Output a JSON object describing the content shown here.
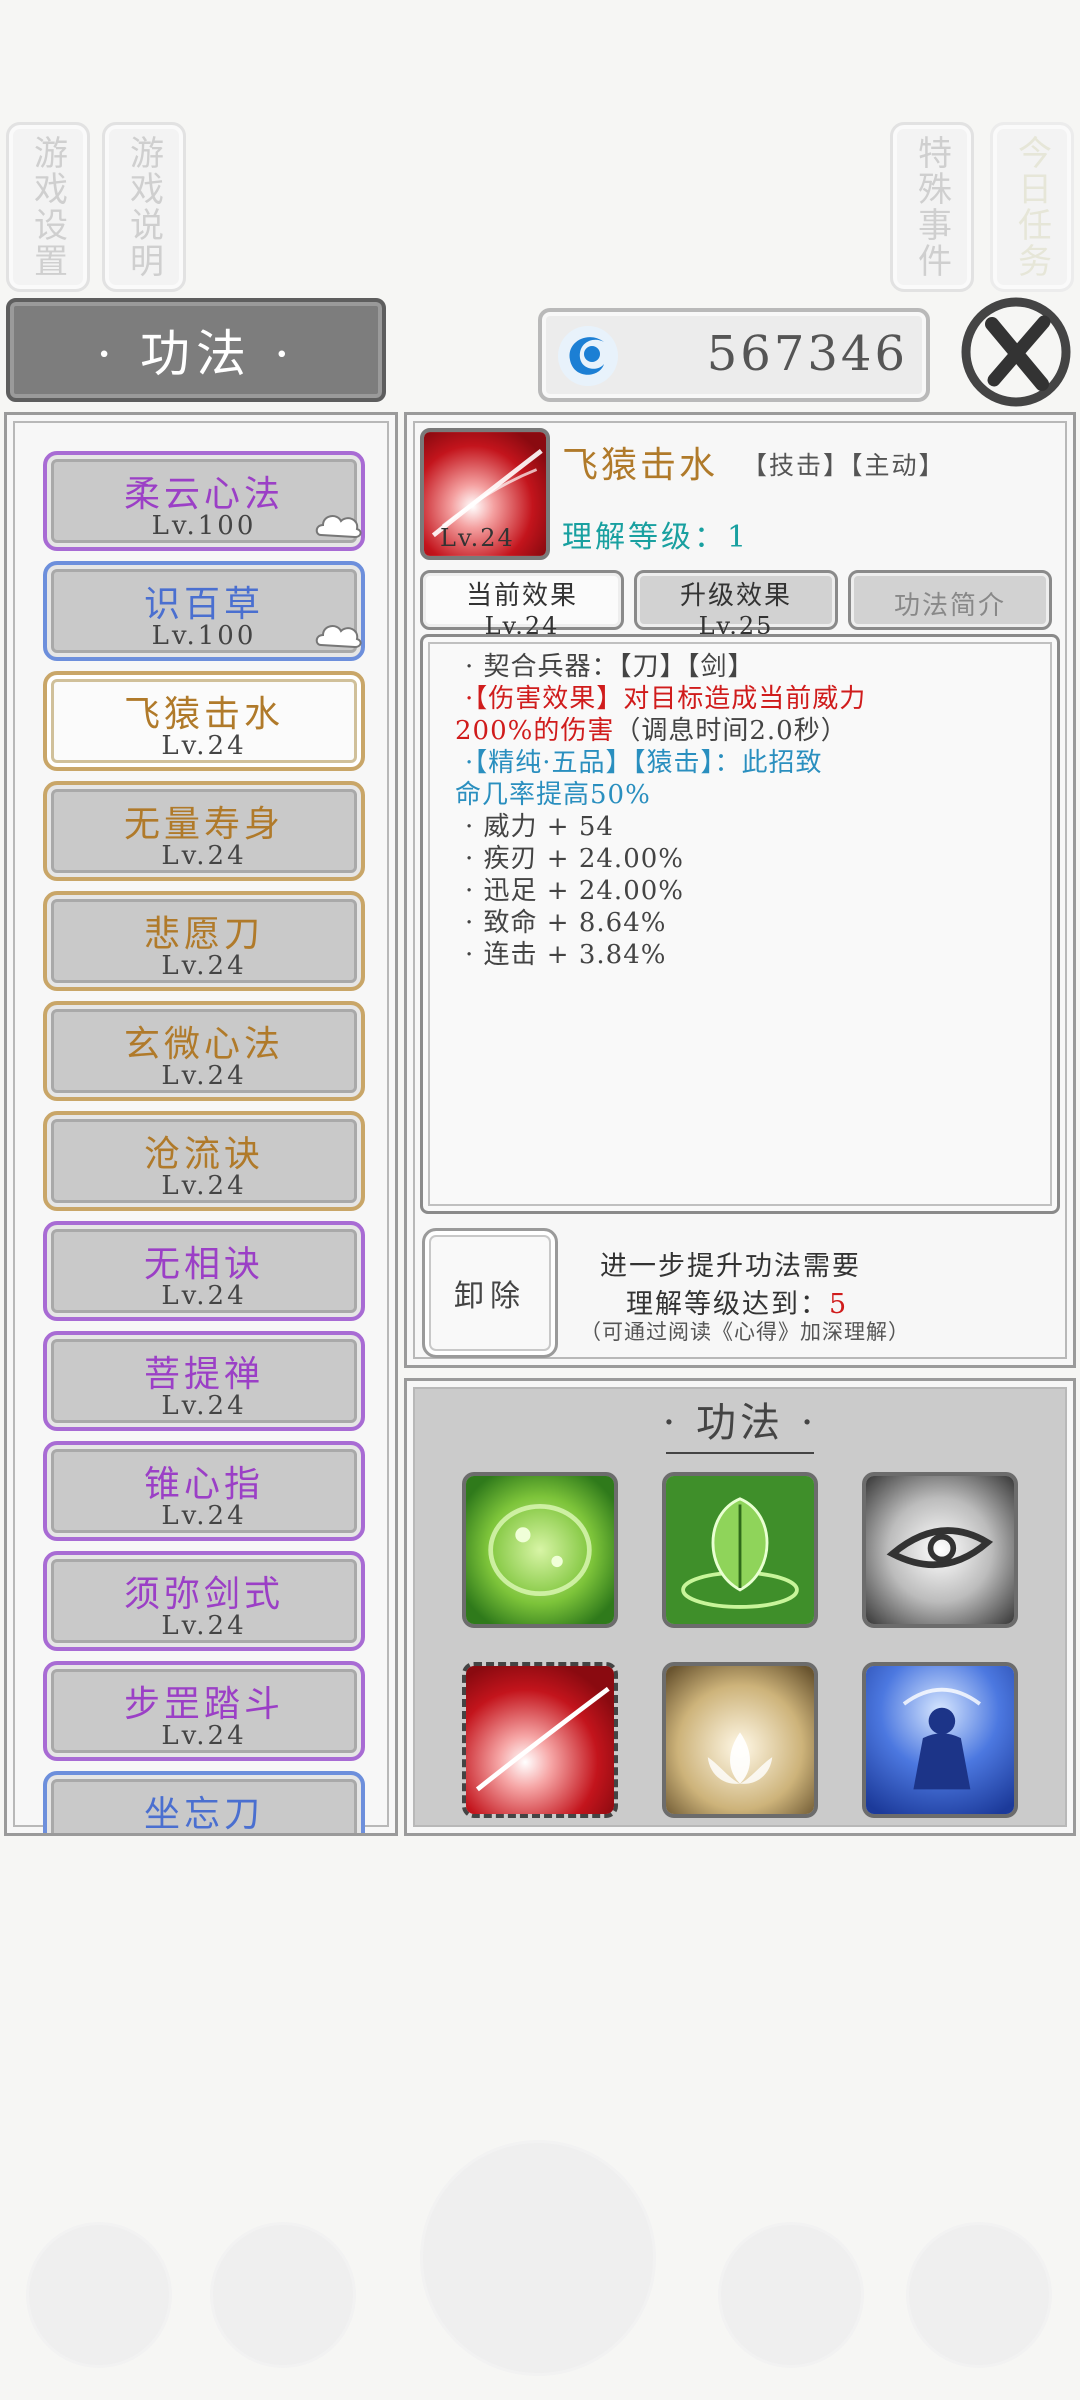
{
  "side_tabs": {
    "settings": "游戏设置",
    "help": "游戏说明",
    "events": "特殊事件",
    "daily": "今日任务"
  },
  "header": {
    "title": "· 功法 ·",
    "currency": "567346",
    "close_icon": "close-x-icon"
  },
  "skill_list": [
    {
      "name": "柔云心法",
      "level": "Lv.100",
      "color": "purple",
      "badge": true
    },
    {
      "name": "识百草",
      "level": "Lv.100",
      "color": "blue",
      "badge": true
    },
    {
      "name": "飞猿击水",
      "level": "Lv.24",
      "color": "gold",
      "active": true
    },
    {
      "name": "无量寿身",
      "level": "Lv.24",
      "color": "gold"
    },
    {
      "name": "悲愿刀",
      "level": "Lv.24",
      "color": "gold"
    },
    {
      "name": "玄微心法",
      "level": "Lv.24",
      "color": "gold"
    },
    {
      "name": "沧流诀",
      "level": "Lv.24",
      "color": "gold"
    },
    {
      "name": "无相诀",
      "level": "Lv.24",
      "color": "purple"
    },
    {
      "name": "菩提禅",
      "level": "Lv.24",
      "color": "purple"
    },
    {
      "name": "锥心指",
      "level": "Lv.24",
      "color": "purple"
    },
    {
      "name": "须弥剑式",
      "level": "Lv.24",
      "color": "purple"
    },
    {
      "name": "步罡踏斗",
      "level": "Lv.24",
      "color": "purple"
    },
    {
      "name": "坐忘刀",
      "level": "",
      "color": "blue"
    }
  ],
  "detail": {
    "icon_level": "Lv.24",
    "name": "飞猿击水",
    "tags": "【技击】【主动】",
    "understanding": "理解等级：1",
    "tabs": [
      {
        "label": "当前效果",
        "sub": "Lv.24"
      },
      {
        "label": "升级效果",
        "sub": "Lv.25"
      },
      {
        "label": "功法简介",
        "sub": ""
      }
    ],
    "effects": {
      "weapon": "· 契合兵器：【刀】【剑】",
      "damage_a": "·【伤害效果】对目标造成当前威力",
      "damage_b_red": "200%的伤害",
      "damage_b_gray": "（调息时间2.0秒）",
      "bonus_a": "·【精纯·五品】【猿击】：此招致",
      "bonus_b": "命几率提高50%",
      "stats": [
        "· 威力 + 54",
        "· 疾刃 + 24.00%",
        "· 迅足 + 24.00%",
        "· 致命 + 8.64%",
        "· 连击 + 3.84%"
      ]
    },
    "unequip": "卸除",
    "requirement_line1": "进一步提升功法需要",
    "requirement_line2": "理解等级达到：",
    "requirement_value": "5",
    "requirement_hint": "（可通过阅读《心得》加深理解）"
  },
  "equipped": {
    "title": "· 功法 ·",
    "slots": [
      "green-orb-icon",
      "green-leaf-icon",
      "eye-icon",
      "red-slash-icon",
      "golden-lotus-icon",
      "blue-monk-icon"
    ]
  }
}
